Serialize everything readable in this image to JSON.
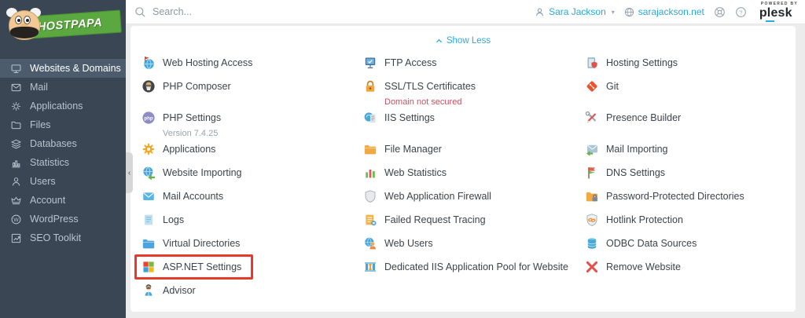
{
  "colors": {
    "accent_blue": "#28aade",
    "danger_red": "#cb4f62",
    "highlight_box_red": "#e8392b",
    "sidebar_bg": "#3a4654",
    "sidebar_active": "#4d5c6d",
    "logo_green": "#5aa83f"
  },
  "sidebar": {
    "logo_text": "HOSTPAPA",
    "collapse_glyph": "‹",
    "items": [
      {
        "label": "Websites & Domains",
        "icon": "monitor-icon",
        "active": true
      },
      {
        "label": "Mail",
        "icon": "mail-icon",
        "active": false
      },
      {
        "label": "Applications",
        "icon": "gear-icon",
        "active": false
      },
      {
        "label": "Files",
        "icon": "folder-icon",
        "active": false
      },
      {
        "label": "Databases",
        "icon": "layers-icon",
        "active": false
      },
      {
        "label": "Statistics",
        "icon": "stats-icon",
        "active": false
      },
      {
        "label": "Users",
        "icon": "user-icon",
        "active": false
      },
      {
        "label": "Account",
        "icon": "crown-icon",
        "active": false
      },
      {
        "label": "WordPress",
        "icon": "wordpress-icon",
        "active": false
      },
      {
        "label": "SEO Toolkit",
        "icon": "seo-icon",
        "active": false
      }
    ]
  },
  "topbar": {
    "search_placeholder": "Search...",
    "user": {
      "name": "Sara Jackson"
    },
    "domain": "sarajackson.net",
    "powered_by_label": "POWERED BY",
    "brand": "plesk"
  },
  "main": {
    "show_less_label": "Show Less",
    "grid_rows": [
      [
        {
          "label": "Web Hosting Access",
          "icon": "globe-flag-icon"
        },
        {
          "label": "FTP Access",
          "icon": "ftp-monitor-icon"
        },
        {
          "label": "Hosting Settings",
          "icon": "scroll-shield-icon"
        }
      ],
      [
        {
          "label": "PHP Composer",
          "icon": "composer-icon"
        },
        {
          "label": "SSL/TLS Certificates",
          "icon": "padlock-icon",
          "subtitle": "Domain not secured",
          "subtitle_style": "danger"
        },
        {
          "label": "Git",
          "icon": "git-icon"
        }
      ],
      [
        {
          "label": "PHP Settings",
          "icon": "php-icon",
          "subtitle": "Version 7.4.25",
          "subtitle_style": "muted"
        },
        {
          "label": "IIS Settings",
          "icon": "iis-icon"
        },
        {
          "label": "Presence Builder",
          "icon": "pencil-wrench-icon"
        }
      ],
      [
        {
          "label": "Applications",
          "icon": "gear-orange-icon"
        },
        {
          "label": "File Manager",
          "icon": "folder-orange-icon"
        },
        {
          "label": "Mail Importing",
          "icon": "mail-import-icon"
        }
      ],
      [
        {
          "label": "Website Importing",
          "icon": "globe-import-icon"
        },
        {
          "label": "Web Statistics",
          "icon": "bar-chart-icon"
        },
        {
          "label": "DNS Settings",
          "icon": "dns-flag-icon"
        }
      ],
      [
        {
          "label": "Mail Accounts",
          "icon": "envelope-icon"
        },
        {
          "label": "Web Application Firewall",
          "icon": "shield-gray-icon"
        },
        {
          "label": "Password-Protected Directories",
          "icon": "folder-lock-icon"
        }
      ],
      [
        {
          "label": "Logs",
          "icon": "document-icon"
        },
        {
          "label": "Failed Request Tracing",
          "icon": "document-error-icon"
        },
        {
          "label": "Hotlink Protection",
          "icon": "shield-link-icon"
        }
      ],
      [
        {
          "label": "Virtual Directories",
          "icon": "folder-blue-icon"
        },
        {
          "label": "Web Users",
          "icon": "globe-user-icon"
        },
        {
          "label": "ODBC Data Sources",
          "icon": "database-icon"
        }
      ],
      [
        {
          "label": "ASP.NET Settings",
          "icon": "ms-squares-icon",
          "highlighted": true
        },
        {
          "label": "Dedicated IIS Application Pool for Website",
          "icon": "iis-pool-icon"
        },
        {
          "label": "Remove Website",
          "icon": "red-x-icon"
        }
      ],
      [
        {
          "label": "Advisor",
          "icon": "advisor-icon"
        },
        null,
        null
      ]
    ]
  }
}
